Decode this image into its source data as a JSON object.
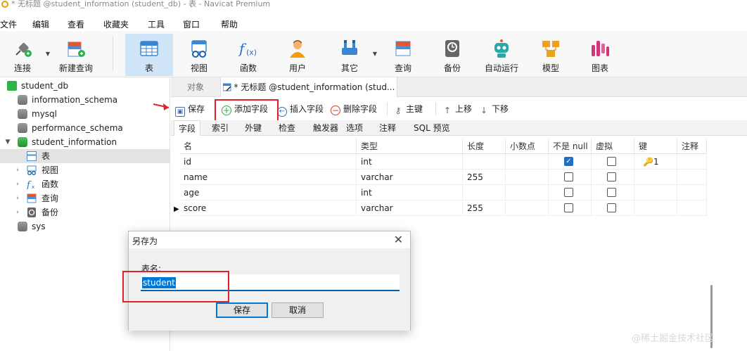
{
  "window": {
    "title": "* 无标题 @student_information (student_db) - 表 - Navicat Premium"
  },
  "menu": [
    "文件",
    "编辑",
    "查看",
    "收藏夹",
    "工具",
    "窗口",
    "帮助"
  ],
  "toolbar": [
    {
      "label": "连接",
      "icon": "plug-icon"
    },
    {
      "label": "新建查询",
      "icon": "new-query-icon"
    },
    {
      "label": "表",
      "icon": "table-icon"
    },
    {
      "label": "视图",
      "icon": "view-icon"
    },
    {
      "label": "函数",
      "icon": "function-icon"
    },
    {
      "label": "用户",
      "icon": "user-icon"
    },
    {
      "label": "其它",
      "icon": "tools-icon"
    },
    {
      "label": "查询",
      "icon": "query-icon"
    },
    {
      "label": "备份",
      "icon": "backup-icon"
    },
    {
      "label": "自动运行",
      "icon": "robot-icon"
    },
    {
      "label": "模型",
      "icon": "model-icon"
    },
    {
      "label": "图表",
      "icon": "chart-icon"
    }
  ],
  "sidebar": {
    "connection": "student_db",
    "databases": [
      "information_schema",
      "mysql",
      "performance_schema",
      "student_information"
    ],
    "children": [
      "表",
      "视图",
      "函数",
      "查询",
      "备份"
    ],
    "last": "sys"
  },
  "tabs": {
    "objects": "对象",
    "active": "* 无标题 @student_information (stud..."
  },
  "actions": {
    "save": "保存",
    "add_field": "添加字段",
    "insert_field": "插入字段",
    "delete_field": "删除字段",
    "primary_key": "主键",
    "move_up": "上移",
    "move_down": "下移"
  },
  "subtabs": [
    "字段",
    "索引",
    "外键",
    "检查",
    "触发器",
    "选项",
    "注释",
    "SQL 预览"
  ],
  "grid": {
    "headers": [
      "名",
      "类型",
      "长度",
      "小数点",
      "不是 null",
      "虚拟",
      "键",
      "注释"
    ],
    "rows": [
      {
        "name": "id",
        "type": "int",
        "length": "",
        "not_null": true,
        "key": "1"
      },
      {
        "name": "name",
        "type": "varchar",
        "length": "255",
        "not_null": false,
        "key": ""
      },
      {
        "name": "age",
        "type": "int",
        "length": "",
        "not_null": false,
        "key": ""
      },
      {
        "name": "score",
        "type": "varchar",
        "length": "255",
        "not_null": false,
        "key": ""
      }
    ]
  },
  "dialog": {
    "title": "另存为",
    "label": "表名:",
    "value": "student",
    "ok": "保存",
    "cancel": "取消"
  },
  "watermark": "@稀土掘金技术社区",
  "colors": {
    "accent": "#0078d7",
    "highlight": "#e0202a",
    "toolbar_active": "#cfe4f7"
  }
}
